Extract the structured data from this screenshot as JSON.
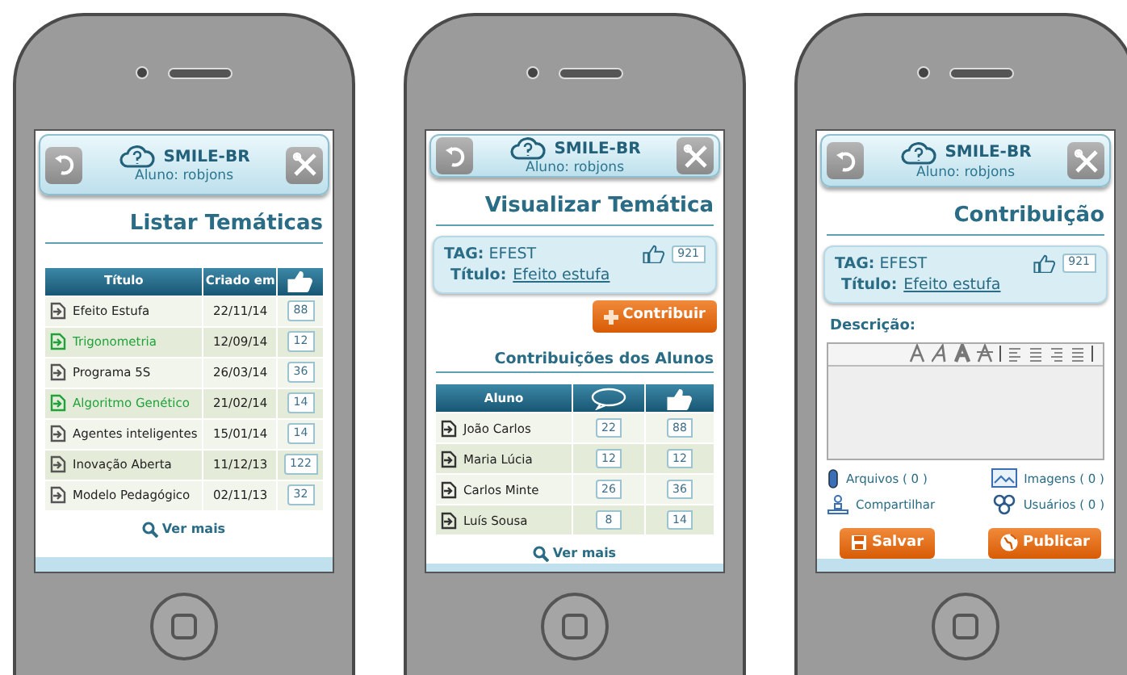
{
  "phones": [
    {
      "kind": "list",
      "header": {
        "app_name": "SMILE-BR",
        "user": "Aluno: robjons"
      },
      "title": "Listar Temáticas",
      "table": {
        "columns": [
          "Título",
          "Criado em"
        ],
        "rows": [
          {
            "title": "Efeito Estufa",
            "date": "22/11/14",
            "likes": "88",
            "highlighted": false
          },
          {
            "title": "Trigonometria",
            "date": "12/09/14",
            "likes": "12",
            "highlighted": true
          },
          {
            "title": "Programa 5S",
            "date": "26/03/14",
            "likes": "36",
            "highlighted": false
          },
          {
            "title": "Algoritmo Genético",
            "date": "21/02/14",
            "likes": "14",
            "highlighted": true
          },
          {
            "title": "Agentes inteligentes",
            "date": "15/01/14",
            "likes": "14",
            "highlighted": false
          },
          {
            "title": "Inovação Aberta",
            "date": "11/12/13",
            "likes": "122",
            "highlighted": false
          },
          {
            "title": "Modelo Pedagógico",
            "date": "02/11/13",
            "likes": "32",
            "highlighted": false
          }
        ]
      },
      "more": "Ver mais"
    },
    {
      "kind": "detail",
      "header": {
        "app_name": "SMILE-BR",
        "user": "Aluno: robjons"
      },
      "title": "Visualizar Temática",
      "topic": {
        "tag": "**TAG:** EFEST",
        "likes": "921",
        "title_label": "Título:",
        "title": "Efeito estufa"
      },
      "contribute_button": "Contribuir",
      "section_title": "Contribuições dos Alunos",
      "table": {
        "columns": [
          "Aluno"
        ],
        "rows": [
          {
            "name": "João Carlos",
            "comments": "22",
            "likes": "88"
          },
          {
            "name": "Maria Lúcia",
            "comments": "12",
            "likes": "12"
          },
          {
            "name": "Carlos Minte",
            "comments": "26",
            "likes": "36"
          },
          {
            "name": "Luís Sousa",
            "comments": "8",
            "likes": "14"
          }
        ]
      },
      "more": "Ver mais"
    },
    {
      "kind": "contribution",
      "header": {
        "app_name": "SMILE-BR",
        "user": "Aluno: robjons"
      },
      "title": "Contribuição",
      "topic": {
        "tag": "**TAG:** EFEST",
        "likes": "921",
        "title_label": "Título:",
        "title": "Efeito estufa"
      },
      "description_label": "Descrição:",
      "attachments": [
        {
          "kind": "files",
          "label": "Arquivos ( 0 )"
        },
        {
          "kind": "images",
          "label": "Imagens ( 0 )"
        },
        {
          "kind": "share",
          "label": "Compartilhar"
        },
        {
          "kind": "users",
          "label": "Usuários ( 0 )"
        }
      ],
      "buttons": [
        {
          "kind": "save",
          "label": "Salvar"
        },
        {
          "kind": "publish",
          "label": "Publicar"
        }
      ]
    }
  ]
}
